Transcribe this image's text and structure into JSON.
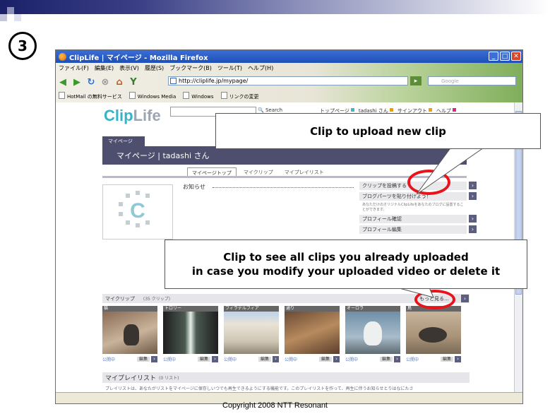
{
  "slide": {
    "step_number": "3",
    "copyright": "Copyright 2008 NTT Resonant"
  },
  "browser": {
    "window_title": "ClipLife | マイページ - Mozilla Firefox",
    "menu": [
      "ファイル(F)",
      "編集(E)",
      "表示(V)",
      "履歴(S)",
      "ブックマーク(B)",
      "ツール(T)",
      "ヘルプ(H)"
    ],
    "url": "http://cliplife.jp/mypage/",
    "search_placeholder": "Google",
    "bookmarks": [
      "HotMail の無料サービス",
      "Windows Media",
      "Windows",
      "リンクの変更"
    ]
  },
  "site": {
    "logo_clip": "Clip",
    "logo_life": "Life",
    "search_button": "Search",
    "top_links": [
      {
        "label": "トップページ",
        "color": "#3fb5d0"
      },
      {
        "label": "tadashi さん",
        "color": "#e8a000"
      },
      {
        "label": "サインアウト",
        "color": "#f0a000"
      },
      {
        "label": "ヘルプ",
        "color": "#e0218a"
      }
    ],
    "mypage_tab": "マイページ",
    "banner_title": "マイページ | tadashi さん",
    "subtabs": [
      "マイページトップ",
      "マイクリップ",
      "マイプレイリスト"
    ],
    "notice_label": "お知らせ",
    "right_links": [
      {
        "label": "クリップを投稿する"
      },
      {
        "label": "ブログパーツを貼り付けよう！",
        "note": "あなただけのオリジナルClipLifeをあなたのブログに設置することができます。"
      },
      {
        "label": "プロフィール確認"
      },
      {
        "label": "プロフィール編集"
      }
    ],
    "myclip_title": "マイクリップ",
    "myclip_count": "(35 クリップ)",
    "more_label": "もっと見る...",
    "clips": [
      {
        "title": "猫",
        "status": "公開中",
        "edit": "編集"
      },
      {
        "title": "トロリー",
        "status": "公開中",
        "edit": "編集"
      },
      {
        "title": "フィラデルフィア",
        "status": "公開中",
        "edit": "編集"
      },
      {
        "title": "通り",
        "status": "公開中",
        "edit": "編集"
      },
      {
        "title": "オーロラ",
        "status": "公開中",
        "edit": "編集"
      },
      {
        "title": "鳥",
        "status": "公開中",
        "edit": "編集"
      }
    ],
    "playlist_title": "マイプレイリスト",
    "playlist_count": "(0 リスト)",
    "playlist_text": "プレイリストは、あなたがリストをマイページに保存しいつでも再生できるようにする機能です。このプレイリストを作って、再生に伴うお知らせとりはなにたさ"
  },
  "callouts": {
    "upload": "Clip to upload new clip",
    "all_clips_line1": "Clip to see all clips you already uploaded",
    "all_clips_line2": "in case you modify your uploaded video or delete it"
  },
  "colors": {
    "highlight_ring": "#e8141c",
    "banner": "#4e4f6e"
  }
}
